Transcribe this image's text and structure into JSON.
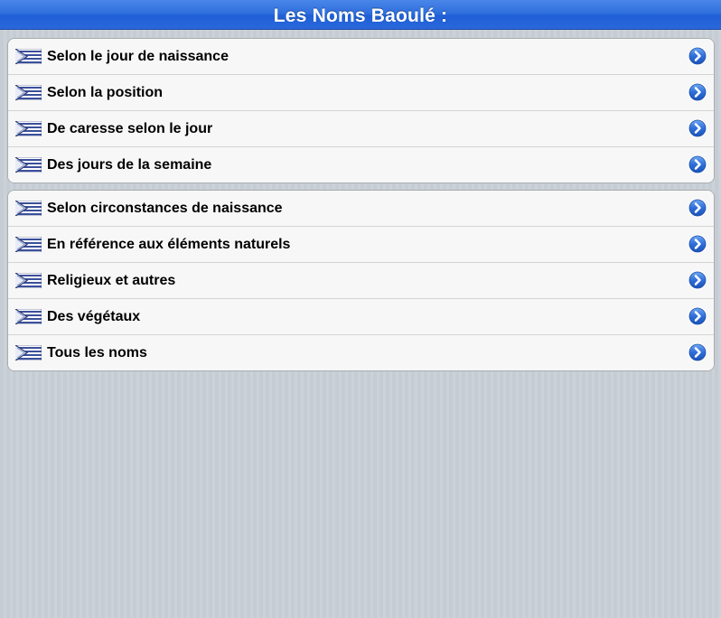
{
  "header": {
    "title": "Les Noms Baoulé :"
  },
  "groups": [
    {
      "items": [
        {
          "label": "Selon le jour de naissance",
          "icon": "flag-icon"
        },
        {
          "label": "Selon la position",
          "icon": "flag-icon"
        },
        {
          "label": "De caresse selon le jour",
          "icon": "flag-icon"
        },
        {
          "label": "Des jours de la semaine",
          "icon": "flag-icon"
        }
      ]
    },
    {
      "items": [
        {
          "label": "Selon circonstances de naissance",
          "icon": "flag-icon"
        },
        {
          "label": "En référence aux éléments naturels",
          "icon": "flag-icon"
        },
        {
          "label": "Religieux et autres",
          "icon": "flag-icon"
        },
        {
          "label": "Des végétaux",
          "icon": "flag-icon"
        },
        {
          "label": "Tous les noms",
          "icon": "flag-icon"
        }
      ]
    }
  ],
  "colors": {
    "header_blue": "#2f6fde",
    "arrow_blue": "#2e6fd8",
    "background": "#c5ccd4",
    "row_background": "#f7f7f7"
  }
}
